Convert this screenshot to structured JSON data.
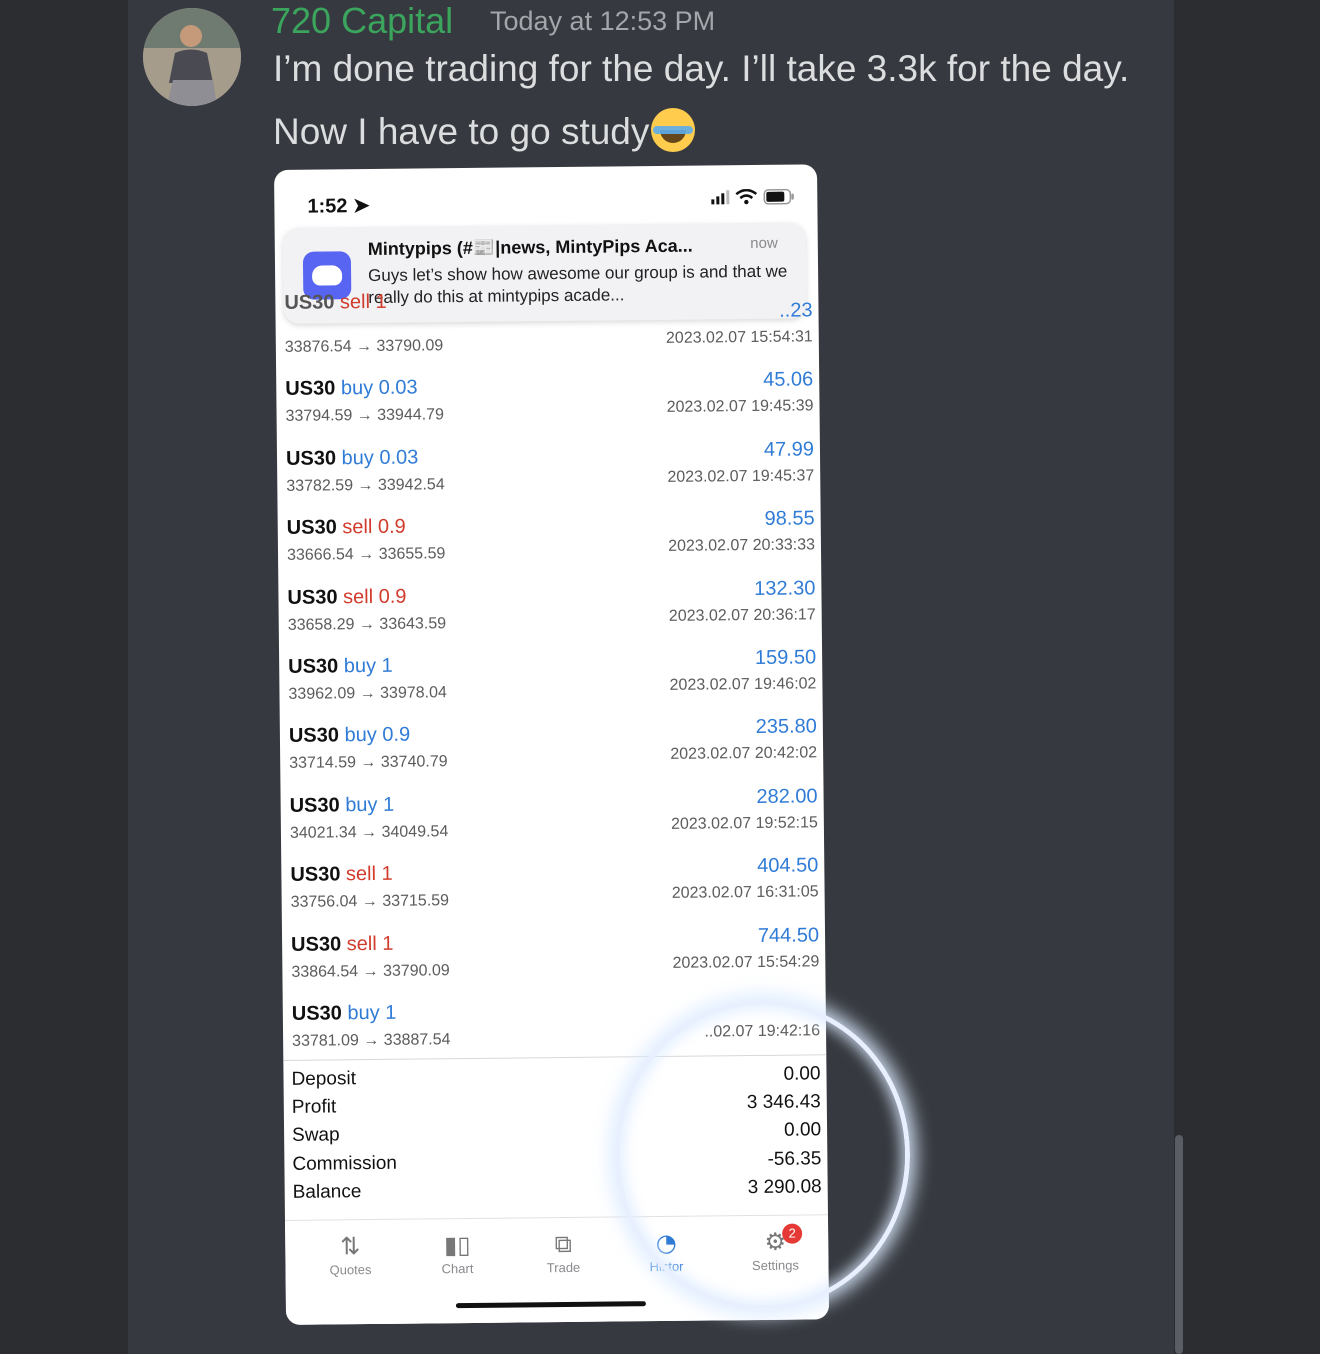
{
  "message": {
    "author": "720 Capital",
    "timestamp": "Today at 12:53 PM",
    "line1": "I’m done trading for the day. I’ll take 3.3k for the day.",
    "line2": "Now I have to go study",
    "emoji": "face-with-tears-of-joy"
  },
  "phone": {
    "status_time": "1:52",
    "notification": {
      "title": "Mintypips (#📰|news, MintyPips Aca...",
      "time": "now",
      "body": "Guys let’s show how awesome our group is and that we really do this at mintypips acade..."
    },
    "trades": [
      {
        "symbol": "US30",
        "side": "sell",
        "side_class": "sell",
        "volume": "1",
        "prices": "33876.54 → 33790.09",
        "profit": "..23",
        "time": "2023.02.07 15:54:31"
      },
      {
        "symbol": "US30",
        "side": "buy",
        "side_class": "buy",
        "volume": "0.03",
        "prices": "33794.59 → 33944.79",
        "profit": "45.06",
        "time": "2023.02.07 19:45:39"
      },
      {
        "symbol": "US30",
        "side": "buy",
        "side_class": "buy",
        "volume": "0.03",
        "prices": "33782.59 → 33942.54",
        "profit": "47.99",
        "time": "2023.02.07 19:45:37"
      },
      {
        "symbol": "US30",
        "side": "sell",
        "side_class": "sell",
        "volume": "0.9",
        "prices": "33666.54 → 33655.59",
        "profit": "98.55",
        "time": "2023.02.07 20:33:33"
      },
      {
        "symbol": "US30",
        "side": "sell",
        "side_class": "sell",
        "volume": "0.9",
        "prices": "33658.29 → 33643.59",
        "profit": "132.30",
        "time": "2023.02.07 20:36:17"
      },
      {
        "symbol": "US30",
        "side": "buy",
        "side_class": "buy",
        "volume": "1",
        "prices": "33962.09 → 33978.04",
        "profit": "159.50",
        "time": "2023.02.07 19:46:02"
      },
      {
        "symbol": "US30",
        "side": "buy",
        "side_class": "buy",
        "volume": "0.9",
        "prices": "33714.59 → 33740.79",
        "profit": "235.80",
        "time": "2023.02.07 20:42:02"
      },
      {
        "symbol": "US30",
        "side": "buy",
        "side_class": "buy",
        "volume": "1",
        "prices": "34021.34 → 34049.54",
        "profit": "282.00",
        "time": "2023.02.07 19:52:15"
      },
      {
        "symbol": "US30",
        "side": "sell",
        "side_class": "sell",
        "volume": "1",
        "prices": "33756.04 → 33715.59",
        "profit": "404.50",
        "time": "2023.02.07 16:31:05"
      },
      {
        "symbol": "US30",
        "side": "sell",
        "side_class": "sell",
        "volume": "1",
        "prices": "33864.54 → 33790.09",
        "profit": "744.50",
        "time": "2023.02.07 15:54:29"
      },
      {
        "symbol": "US30",
        "side": "buy",
        "side_class": "buy",
        "volume": "1",
        "prices": "33781.09 → 33887.54",
        "profit": "",
        "time": "..02.07 19:42:16"
      }
    ],
    "summary": [
      {
        "label": "Deposit",
        "value": "0.00"
      },
      {
        "label": "Profit",
        "value": "3 346.43"
      },
      {
        "label": "Swap",
        "value": "0.00"
      },
      {
        "label": "Commission",
        "value": "-56.35"
      },
      {
        "label": "Balance",
        "value": "3 290.08"
      }
    ],
    "tabs": {
      "quotes": "Quotes",
      "chart": "Chart",
      "trade": "Trade",
      "history": "Histor",
      "settings": "Settings",
      "settings_badge": "2"
    },
    "colors": {
      "buy": "#2f7bd6",
      "sell": "#d13b2b",
      "author": "#3ba55d"
    }
  }
}
